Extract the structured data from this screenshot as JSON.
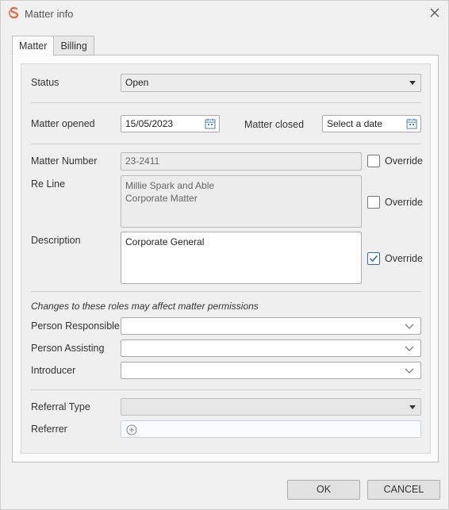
{
  "window": {
    "title": "Matter info"
  },
  "tabs": [
    {
      "label": "Matter",
      "active": true
    },
    {
      "label": "Billing",
      "active": false
    }
  ],
  "status": {
    "label": "Status",
    "value": "Open"
  },
  "dates": {
    "opened_label": "Matter opened",
    "opened_value": "15/05/2023",
    "closed_label": "Matter closed",
    "closed_placeholder": "Select a date"
  },
  "matter_number": {
    "label": "Matter Number",
    "value": "23-2411",
    "override_label": "Override",
    "override_checked": false
  },
  "re_line": {
    "label": "Re Line",
    "line1": "Millie Spark and Able",
    "line2": "Corporate Matter",
    "override_label": "Override",
    "override_checked": false
  },
  "description": {
    "label": "Description",
    "value": "Corporate General",
    "override_label": "Override",
    "override_checked": true
  },
  "roles": {
    "note": "Changes to these roles may affect matter permissions",
    "person_responsible_label": "Person Responsible",
    "person_responsible_value": "",
    "person_assisting_label": "Person Assisting",
    "person_assisting_value": "",
    "introducer_label": "Introducer",
    "introducer_value": ""
  },
  "referral": {
    "type_label": "Referral Type",
    "type_value": "",
    "referrer_label": "Referrer"
  },
  "buttons": {
    "ok": "OK",
    "cancel": "CANCEL"
  },
  "colors": {
    "accent": "#2d6db5",
    "logo": "#e8643c"
  },
  "icons": [
    "app-logo-icon",
    "close-icon",
    "calendar-icon",
    "chevron-down-icon",
    "dropdown-arrow-icon",
    "checkmark-icon",
    "add-circle-icon"
  ]
}
